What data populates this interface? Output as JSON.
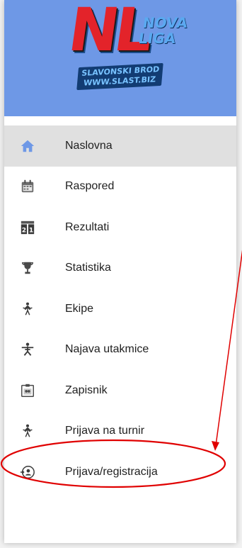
{
  "header": {
    "logo_main": "NL",
    "logo_nova": "NOVA",
    "logo_liga": "LIGA",
    "logo_city": "SLAVONSKI BROD",
    "logo_site": "WWW.SLAST.BIZ",
    "background_color": "#6e98e6"
  },
  "menu": {
    "items": [
      {
        "label": "Naslovna",
        "icon": "home-icon",
        "active": true
      },
      {
        "label": "Raspored",
        "icon": "calendar-icon",
        "active": false
      },
      {
        "label": "Rezultati",
        "icon": "scoreboard-icon",
        "active": false
      },
      {
        "label": "Statistika",
        "icon": "trophy-icon",
        "active": false
      },
      {
        "label": "Ekipe",
        "icon": "team-icon",
        "active": false
      },
      {
        "label": "Najava utakmice",
        "icon": "player-icon",
        "active": false
      },
      {
        "label": "Zapisnik",
        "icon": "record-icon",
        "active": false
      },
      {
        "label": "Prijava na turnir",
        "icon": "team-icon",
        "active": false
      },
      {
        "label": "Prijava/registracija",
        "icon": "login-icon",
        "active": false
      }
    ],
    "active_bg": "#e0e0e0",
    "active_icon_color": "#6e98e6"
  },
  "annotation": {
    "color": "#e00000",
    "target": "Prijava/registracija"
  }
}
